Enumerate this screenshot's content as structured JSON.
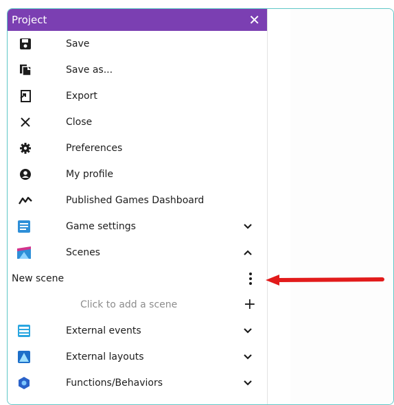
{
  "panel": {
    "title": "Project",
    "close_label": "✕",
    "menu_items": [
      {
        "label": "Save",
        "icon": "save-icon"
      },
      {
        "label": "Save as...",
        "icon": "copy-icon"
      },
      {
        "label": "Export",
        "icon": "export-icon"
      },
      {
        "label": "Close",
        "icon": "close-icon"
      },
      {
        "label": "Preferences",
        "icon": "gear-icon"
      },
      {
        "label": "My profile",
        "icon": "profile-icon"
      },
      {
        "label": "Published Games Dashboard",
        "icon": "trend-icon"
      }
    ],
    "sections": {
      "game_settings": "Game settings",
      "scenes": "Scenes",
      "new_scene": "New scene",
      "add_scene": "Click to add a scene",
      "external_events": "External events",
      "external_layouts": "External layouts",
      "functions": "Functions/Behaviors"
    }
  },
  "colors": {
    "header": "#7b3fb2",
    "accent_frame": "#5ec6c6",
    "arrow": "#e21b1b"
  }
}
